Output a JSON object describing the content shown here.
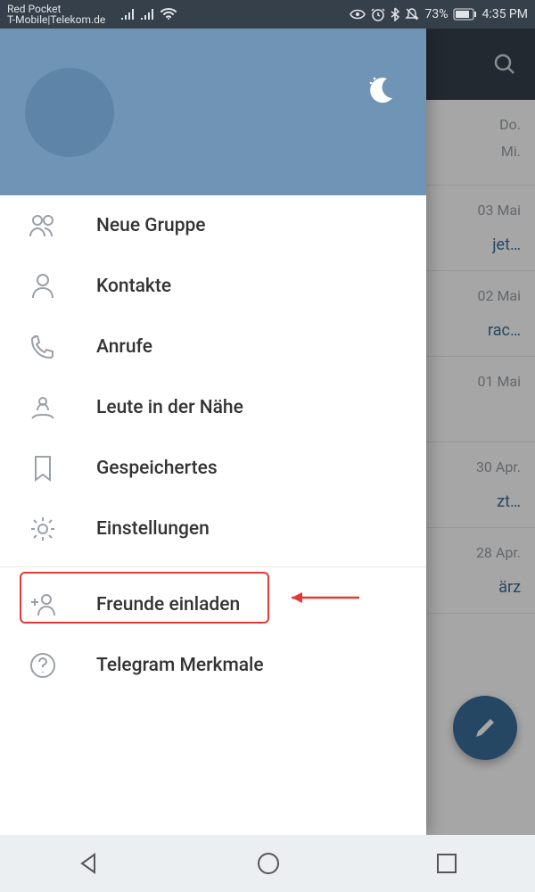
{
  "status": {
    "carrier1": "Red Pocket",
    "carrier2": "T-Mobile|Telekom.de",
    "battery": "73%",
    "time": "4:35 PM"
  },
  "drawer": {
    "items": [
      {
        "label": "Neue Gruppe"
      },
      {
        "label": "Kontakte"
      },
      {
        "label": "Anrufe"
      },
      {
        "label": "Leute in der Nähe"
      },
      {
        "label": "Gespeichertes"
      },
      {
        "label": "Einstellungen"
      },
      {
        "label": "Freunde einladen"
      },
      {
        "label": "Telegram Merkmale"
      }
    ]
  },
  "chats": [
    {
      "date": "Do.",
      "date2": "Mi.",
      "snippet": ""
    },
    {
      "date": "03 Mai",
      "snippet": "jet…"
    },
    {
      "date": "02 Mai",
      "snippet": "rac…"
    },
    {
      "date": "01 Mai",
      "snippet": ""
    },
    {
      "date": "30 Apr.",
      "snippet": "zt…"
    },
    {
      "date": "28 Apr.",
      "snippet": "ärz"
    }
  ]
}
